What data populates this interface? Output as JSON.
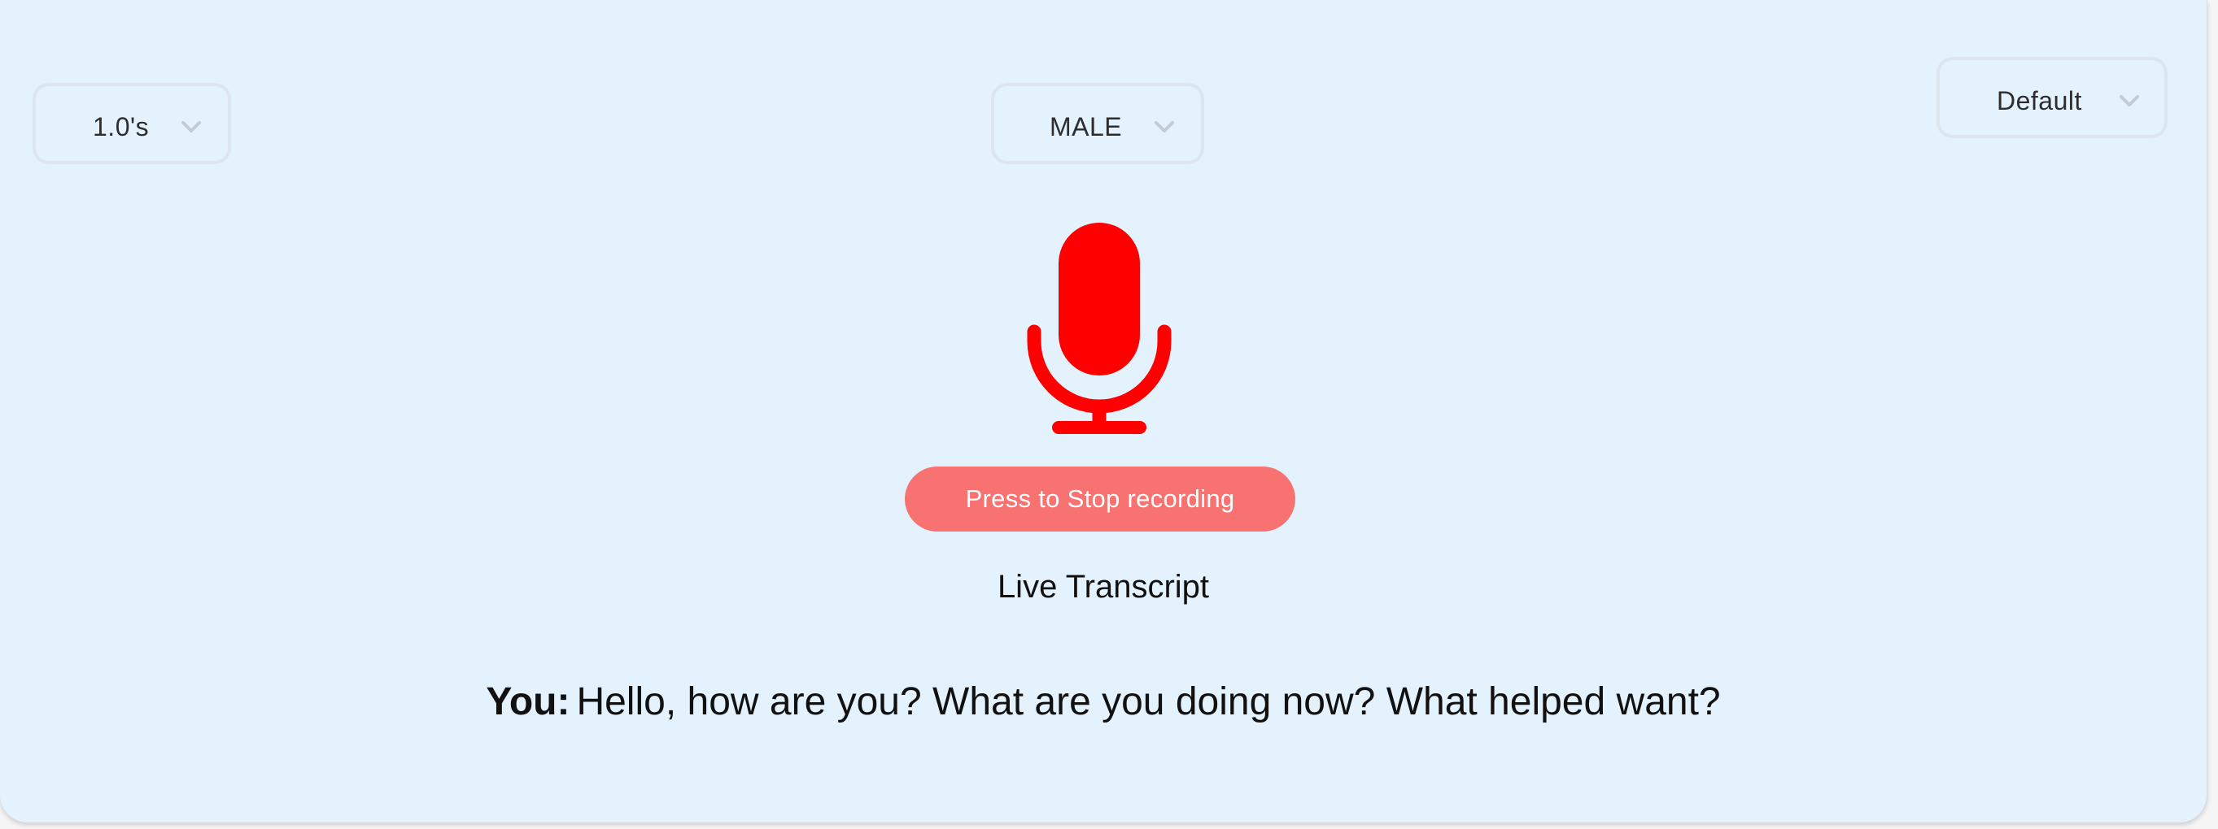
{
  "controls": {
    "speed": {
      "value": "1.0's",
      "icon": "chevron-down-icon"
    },
    "voice": {
      "value": "MALE",
      "icon": "chevron-down-icon"
    },
    "style": {
      "value": "Default",
      "icon": "chevron-down-icon"
    }
  },
  "recorder": {
    "mic_icon": "microphone-icon",
    "mic_color": "#ff0000",
    "button_label": "Press to Stop recording",
    "button_color": "#f87272"
  },
  "transcript": {
    "title": "Live Transcript",
    "speaker": "You:",
    "text": "Hello, how are you? What are you doing now? What helped want?"
  },
  "colors": {
    "background": "#e4f2fe",
    "select_border": "#dde6ee"
  }
}
